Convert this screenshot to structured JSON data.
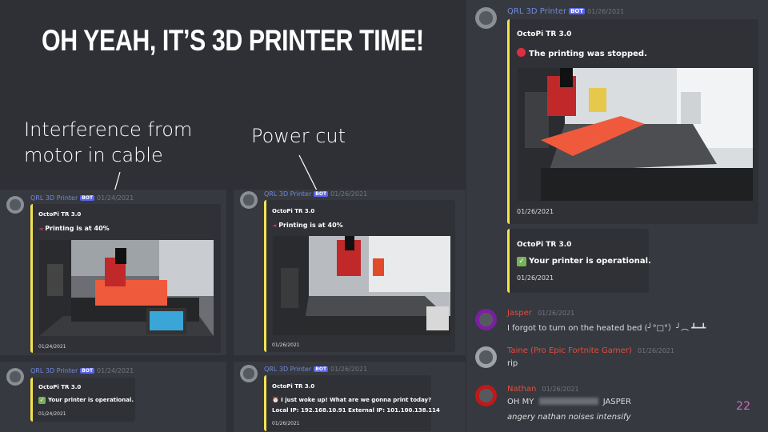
{
  "slide": {
    "title": "OH YEAH, IT’S 3D PRINTER TIME!",
    "note_left_line1": "Interference from",
    "note_left_line2": "motor in cable",
    "note_mid": "Power cut",
    "page_number": "22"
  },
  "left_panel": {
    "msg1": {
      "author": "QRL 3D Printer",
      "badge": "BOT",
      "timestamp": "01/24/2021",
      "embed_title": "OctoPi TR 3.0",
      "embed_icon": "megaphone-icon",
      "embed_text": "Printing is at 40%",
      "embed_date": "01/24/2021"
    },
    "msg2": {
      "author": "QRL 3D Printer",
      "badge": "BOT",
      "timestamp": "01/24/2021",
      "embed_title": "OctoPi TR 3.0",
      "embed_icon": "check-icon",
      "embed_text": "Your printer is operational.",
      "embed_date": "01/24/2021"
    }
  },
  "mid_panel": {
    "msg1": {
      "author": "QRL 3D Printer",
      "badge": "BOT",
      "timestamp": "01/26/2021",
      "embed_title": "OctoPi TR 3.0",
      "embed_icon": "megaphone-icon",
      "embed_text": "Printing is at 40%",
      "embed_date": "01/26/2021"
    },
    "msg2": {
      "author": "QRL 3D Printer",
      "badge": "BOT",
      "timestamp": "01/26/2021",
      "embed_title": "OctoPi TR 3.0",
      "embed_icon": "alarm-clock-icon",
      "embed_text_line1": "I just woke up! What are we gonna print today?",
      "embed_text_line2": "Local IP: 192.168.10.91 External IP: 101.100.138.114",
      "embed_date": "01/26/2021"
    }
  },
  "right_panel": {
    "msg1": {
      "author": "QRL 3D Printer",
      "badge": "BOT",
      "timestamp": "01/26/2021",
      "embed_title": "OctoPi TR 3.0",
      "embed_icon": "red-circle-icon",
      "embed_text": "The printing was stopped.",
      "embed_date": "01/26/2021"
    },
    "msg2": {
      "embed_title": "OctoPi TR 3.0",
      "embed_icon": "check-icon",
      "embed_text": "Your printer is operational.",
      "embed_date": "01/26/2021"
    },
    "chat": [
      {
        "author": "Jasper",
        "timestamp": "01/26/2021",
        "text": "I forgot to turn on the heated bed (╯°□°）╯︵ ┻━┻",
        "color": "#e74c3c"
      },
      {
        "author": "Taine (Pro Epic Fortnite Gamer)",
        "timestamp": "01/26/2021",
        "text": "rip",
        "color": "#e74c3c"
      },
      {
        "author": "Nathan",
        "timestamp": "01/26/2021",
        "text_before": "OH MY",
        "text_after": "JASPER",
        "text2": "angery nathan noises intensify",
        "color": "#e74c3c"
      }
    ]
  },
  "colors": {
    "slide_bg": "#2e3035",
    "discord_bg": "#36393f",
    "embed_bg": "#2f3136",
    "embed_accent": "#f4e34e",
    "bot_badge": "#5865f2",
    "username_red": "#e74c3c",
    "page_number": "#c86fbf"
  }
}
